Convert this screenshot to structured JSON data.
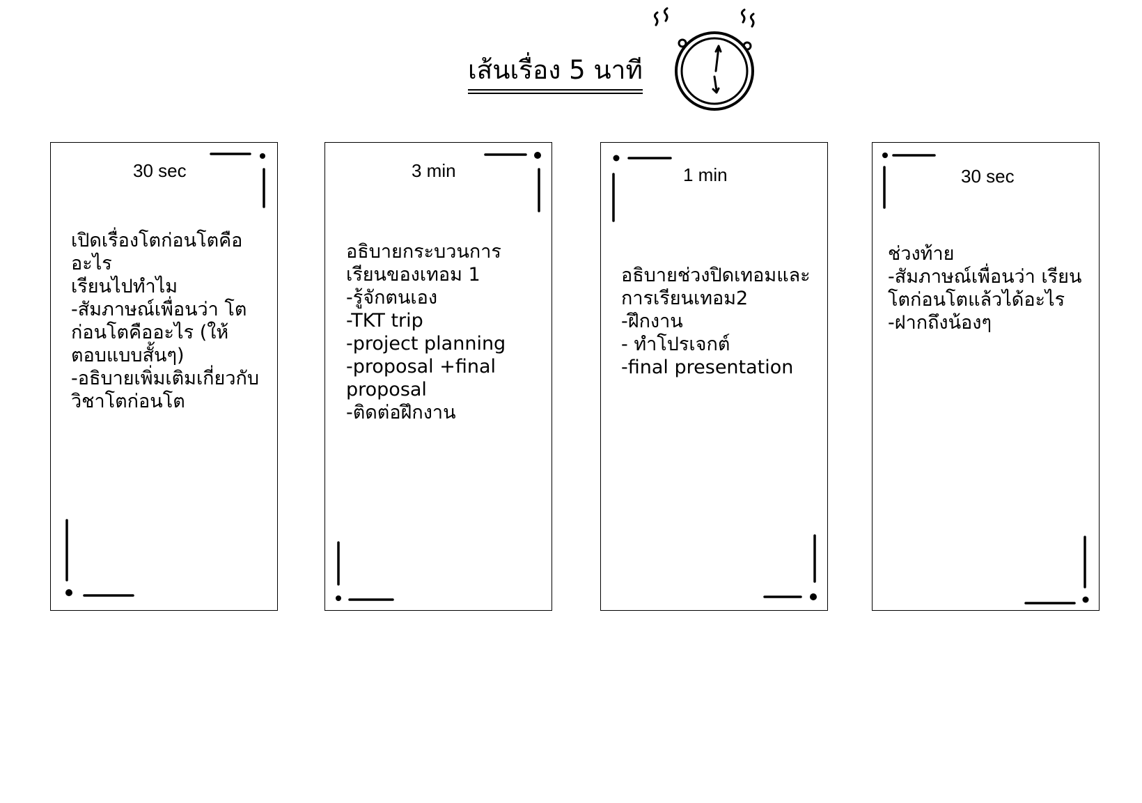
{
  "title": "เส้นเรื่อง 5 นาที",
  "icon": "stopwatch-icon",
  "cards": [
    {
      "duration": "30 sec",
      "lines": [
        "เปิดเรื่องโตก่อนโตคือ",
        "อะไร",
        "เรียนไปทำไม",
        "-สัมภาษณ์เพื่อนว่า โต",
        "ก่อนโตคืออะไร (ให้",
        "ตอบแบบสั้นๆ)",
        "-อธิบายเพิ่มเติมเกี่ยวกับ",
        "วิชาโตก่อนโต"
      ]
    },
    {
      "duration": "3 min",
      "lines": [
        "อธิบายกระบวนการ",
        "เรียนของเทอม 1",
        "-รู้จักตนเอง",
        "-TKT trip",
        "-project planning",
        "-proposal +final",
        "proposal",
        "-ติดต่อฝึกงาน"
      ]
    },
    {
      "duration": "1 min",
      "lines": [
        "อธิบายช่วงปิดเทอมและ",
        "การเรียนเทอม2",
        "-ฝึกงาน",
        "- ทำโปรเจกต์",
        "-final presentation"
      ]
    },
    {
      "duration": "30 sec",
      "lines": [
        "ช่วงท้าย",
        "-สัมภาษณ์เพื่อนว่า เรียน",
        "โตก่อนโตแล้วได้อะไร",
        "-ฝากถึงน้องๆ"
      ]
    }
  ]
}
